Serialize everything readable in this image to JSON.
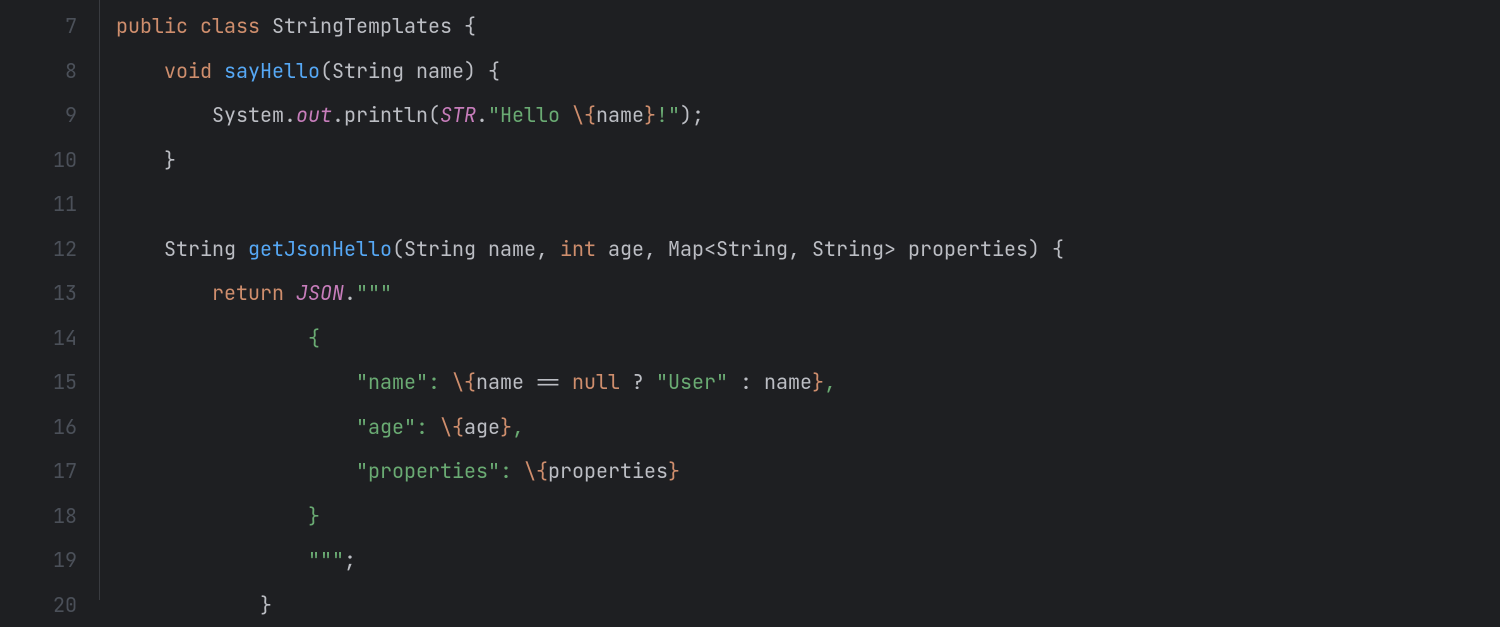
{
  "gutter": {
    "start": 7,
    "end": 20
  },
  "colors": {
    "bg": "#1e1f22",
    "fg": "#bcbec4",
    "gutter": "#4b5059",
    "keyword": "#cf8e6d",
    "method_decl": "#56a8f5",
    "static_ref": "#c77dbb",
    "string": "#6aab73"
  },
  "code": {
    "lines": [
      {
        "num": 7,
        "tokens": [
          {
            "t": "public ",
            "c": "kw"
          },
          {
            "t": "class ",
            "c": "kw"
          },
          {
            "t": "StringTemplates ",
            "c": "type"
          },
          {
            "t": "{",
            "c": "punct"
          }
        ]
      },
      {
        "num": 8,
        "indent": 1,
        "tokens": [
          {
            "t": "void ",
            "c": "kw"
          },
          {
            "t": "sayHello",
            "c": "fn"
          },
          {
            "t": "(String name) {",
            "c": "plain"
          }
        ]
      },
      {
        "num": 9,
        "indent": 2,
        "tokens": [
          {
            "t": "System.",
            "c": "plain"
          },
          {
            "t": "out",
            "c": "static"
          },
          {
            "t": ".println(",
            "c": "plain"
          },
          {
            "t": "STR",
            "c": "static"
          },
          {
            "t": ".",
            "c": "plain"
          },
          {
            "t": "\"Hello ",
            "c": "str"
          },
          {
            "t": "\\{",
            "c": "kw"
          },
          {
            "t": "name",
            "c": "plain"
          },
          {
            "t": "}",
            "c": "kw"
          },
          {
            "t": "!\"",
            "c": "str"
          },
          {
            "t": ");",
            "c": "plain"
          }
        ]
      },
      {
        "num": 10,
        "indent": 1,
        "tokens": [
          {
            "t": "}",
            "c": "punct"
          }
        ]
      },
      {
        "num": 11,
        "tokens": []
      },
      {
        "num": 12,
        "indent": 1,
        "tokens": [
          {
            "t": "String ",
            "c": "type"
          },
          {
            "t": "getJsonHello",
            "c": "fn"
          },
          {
            "t": "(String name, ",
            "c": "plain"
          },
          {
            "t": "int ",
            "c": "kw"
          },
          {
            "t": "age, Map<String, String> properties) {",
            "c": "plain"
          }
        ]
      },
      {
        "num": 13,
        "indent": 2,
        "tokens": [
          {
            "t": "return ",
            "c": "kw"
          },
          {
            "t": "JSON",
            "c": "static"
          },
          {
            "t": ".",
            "c": "plain"
          },
          {
            "t": "\"\"\"",
            "c": "str"
          }
        ]
      },
      {
        "num": 14,
        "indent": 4,
        "tokens": [
          {
            "t": "{",
            "c": "str"
          }
        ]
      },
      {
        "num": 15,
        "indent": 5,
        "tokens": [
          {
            "t": "\"name\": ",
            "c": "str"
          },
          {
            "t": "\\{",
            "c": "kw"
          },
          {
            "t": "name == ",
            "c": "plain"
          },
          {
            "t": "null ",
            "c": "kw"
          },
          {
            "t": "? ",
            "c": "plain"
          },
          {
            "t": "\"User\" ",
            "c": "str"
          },
          {
            "t": ": name",
            "c": "plain"
          },
          {
            "t": "}",
            "c": "kw"
          },
          {
            "t": ",",
            "c": "str"
          }
        ]
      },
      {
        "num": 16,
        "indent": 5,
        "tokens": [
          {
            "t": "\"age\": ",
            "c": "str"
          },
          {
            "t": "\\{",
            "c": "kw"
          },
          {
            "t": "age",
            "c": "plain"
          },
          {
            "t": "}",
            "c": "kw"
          },
          {
            "t": ",",
            "c": "str"
          }
        ]
      },
      {
        "num": 17,
        "indent": 5,
        "tokens": [
          {
            "t": "\"properties\": ",
            "c": "str"
          },
          {
            "t": "\\{",
            "c": "kw"
          },
          {
            "t": "properties",
            "c": "plain"
          },
          {
            "t": "}",
            "c": "kw"
          }
        ]
      },
      {
        "num": 18,
        "indent": 4,
        "tokens": [
          {
            "t": "}",
            "c": "str"
          }
        ]
      },
      {
        "num": 19,
        "indent": 4,
        "tokens": [
          {
            "t": "\"\"\"",
            "c": "str"
          },
          {
            "t": ";",
            "c": "plain"
          }
        ]
      },
      {
        "num": 20,
        "indent": 3,
        "tokens": [
          {
            "t": "}",
            "c": "punct"
          }
        ],
        "partial": true
      }
    ]
  }
}
